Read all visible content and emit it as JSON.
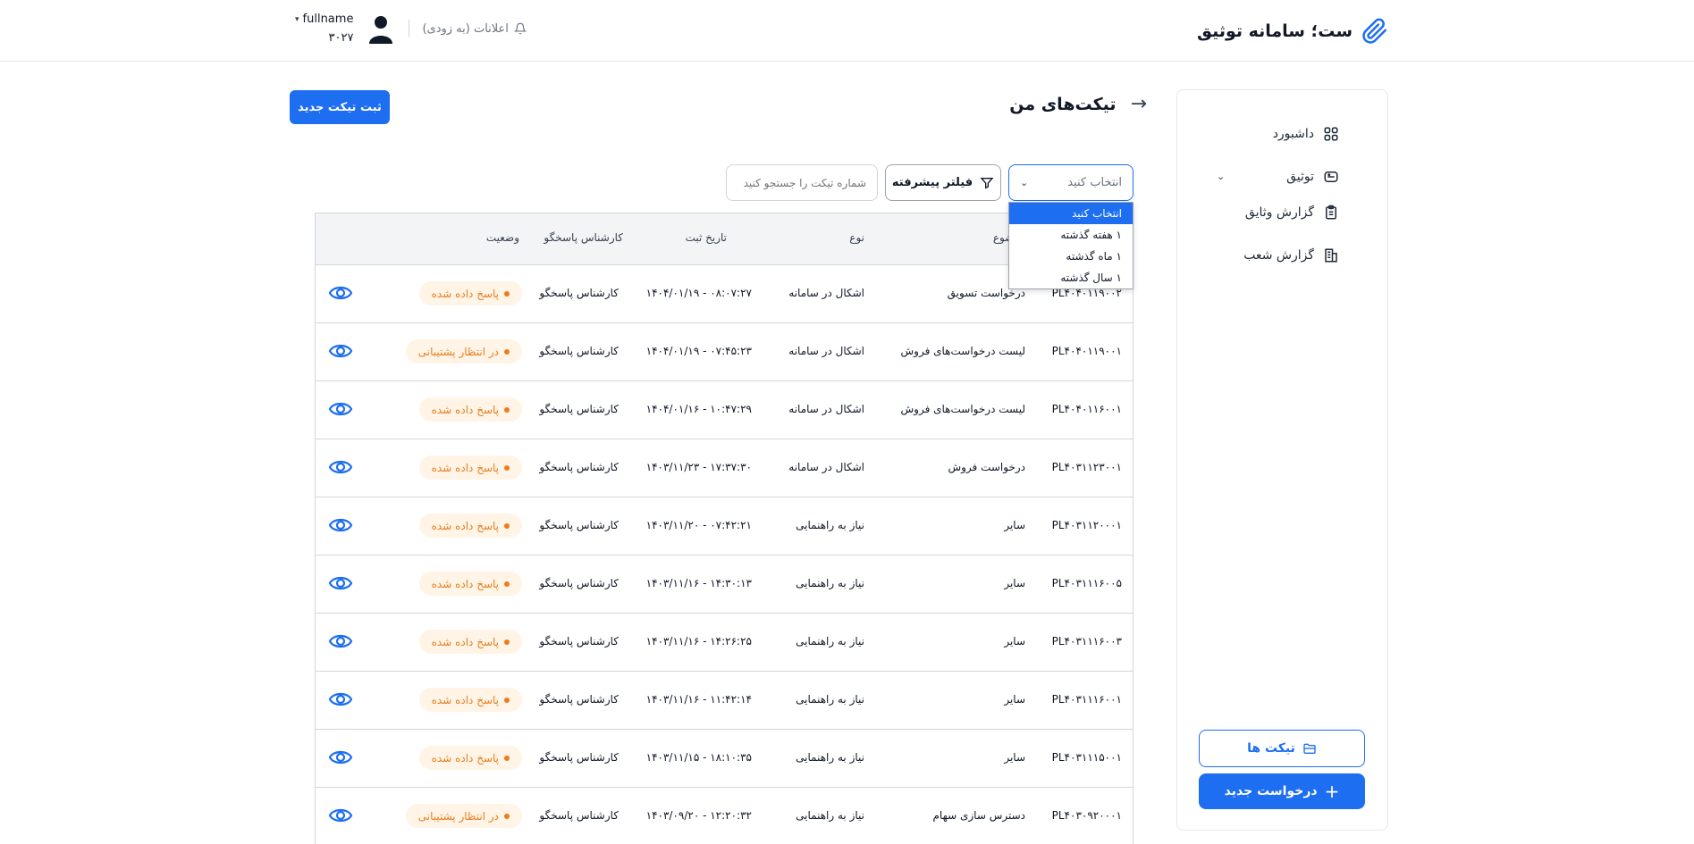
{
  "header": {
    "brand_title": "ست؛ سامانه توثیق",
    "notifications_label": "اعلانات (به زودی)",
    "user_name": "fullname",
    "user_id": "۳۰۲۷"
  },
  "sidebar": {
    "items": [
      {
        "label": "داشبورد",
        "icon": "dashboard-grid-icon"
      },
      {
        "label": "توثیق",
        "icon": "database-icon"
      },
      {
        "label": "گزارش وثایق",
        "icon": "clipboard-icon"
      },
      {
        "label": "گزارش شعب",
        "icon": "building-icon"
      }
    ],
    "tickets_button": "تیکت ها",
    "new_request_button": "درخواست جدید"
  },
  "page": {
    "title": "تیکت‌های من",
    "new_ticket_button": "ثبت تیکت جدید"
  },
  "filters": {
    "select_value": "انتخاب کنید",
    "advanced_filter": "فیلتر پیشرفته",
    "search_placeholder": "شماره تیکت را جستجو کنید",
    "dropdown_options": [
      "انتخاب کنید",
      "۱ هفته گذشته",
      "۱ ماه گذشته",
      "۱ سال گذشته"
    ]
  },
  "table": {
    "headers": {
      "subject": "موضوع",
      "type": "نوع",
      "date": "تاریخ ثبت",
      "expert": "کارشناس پاسخگو",
      "status": "وضعیت"
    },
    "rows": [
      {
        "id": "PL۴۰۴۰۱۱۹۰۰۲",
        "subject": "درخواست تسویق",
        "type": "اشکال در سامانه",
        "date": "۱۴۰۴/۰۱/۱۹ - ۰۸:۰۷:۲۷",
        "expert": "کارشناس پاسخگو",
        "status": "پاسخ داده شده"
      },
      {
        "id": "PL۴۰۴۰۱۱۹۰۰۱",
        "subject": "لیست درخواست‌های فروش",
        "type": "اشکال در سامانه",
        "date": "۱۴۰۴/۰۱/۱۹ - ۰۷:۴۵:۲۳",
        "expert": "کارشناس پاسخگو",
        "status": "در انتظار پشتیبانی"
      },
      {
        "id": "PL۴۰۴۰۱۱۶۰۰۱",
        "subject": "لیست درخواست‌های فروش",
        "type": "اشکال در سامانه",
        "date": "۱۴۰۴/۰۱/۱۶ - ۱۰:۴۷:۲۹",
        "expert": "کارشناس پاسخگو",
        "status": "پاسخ داده شده"
      },
      {
        "id": "PL۴۰۳۱۱۲۳۰۰۱",
        "subject": "درخواست فروش",
        "type": "اشکال در سامانه",
        "date": "۱۴۰۳/۱۱/۲۳ - ۱۷:۳۷:۳۰",
        "expert": "کارشناس پاسخگو",
        "status": "پاسخ داده شده"
      },
      {
        "id": "PL۴۰۳۱۱۲۰۰۰۱",
        "subject": "سایر",
        "type": "نیاز به راهنمایی",
        "date": "۱۴۰۳/۱۱/۲۰ - ۰۷:۴۲:۲۱",
        "expert": "کارشناس پاسخگو",
        "status": "پاسخ داده شده"
      },
      {
        "id": "PL۴۰۳۱۱۱۶۰۰۵",
        "subject": "سایر",
        "type": "نیاز به راهنمایی",
        "date": "۱۴۰۳/۱۱/۱۶ - ۱۴:۳۰:۱۳",
        "expert": "کارشناس پاسخگو",
        "status": "پاسخ داده شده"
      },
      {
        "id": "PL۴۰۳۱۱۱۶۰۰۳",
        "subject": "سایر",
        "type": "نیاز به راهنمایی",
        "date": "۱۴۰۳/۱۱/۱۶ - ۱۴:۲۶:۲۵",
        "expert": "کارشناس پاسخگو",
        "status": "پاسخ داده شده"
      },
      {
        "id": "PL۴۰۳۱۱۱۶۰۰۱",
        "subject": "سایر",
        "type": "نیاز به راهنمایی",
        "date": "۱۴۰۳/۱۱/۱۶ - ۱۱:۴۲:۱۴",
        "expert": "کارشناس پاسخگو",
        "status": "پاسخ داده شده"
      },
      {
        "id": "PL۴۰۳۱۱۱۵۰۰۱",
        "subject": "سایر",
        "type": "نیاز به راهنمایی",
        "date": "۱۴۰۳/۱۱/۱۵ - ۱۸:۱۰:۳۵",
        "expert": "کارشناس پاسخگو",
        "status": "پاسخ داده شده"
      },
      {
        "id": "PL۴۰۳۰۹۲۰۰۰۱",
        "subject": "دسترس سازی سهام",
        "type": "نیاز به راهنمایی",
        "date": "۱۴۰۳/۰۹/۲۰ - ۱۲:۲۰:۳۲",
        "expert": "کارشناس پاسخگو",
        "status": "در انتظار پشتیبانی"
      }
    ]
  },
  "colors": {
    "accent": "#1d6ef0",
    "status_orange": "#e67e22",
    "status_bg": "#fff4e5"
  }
}
